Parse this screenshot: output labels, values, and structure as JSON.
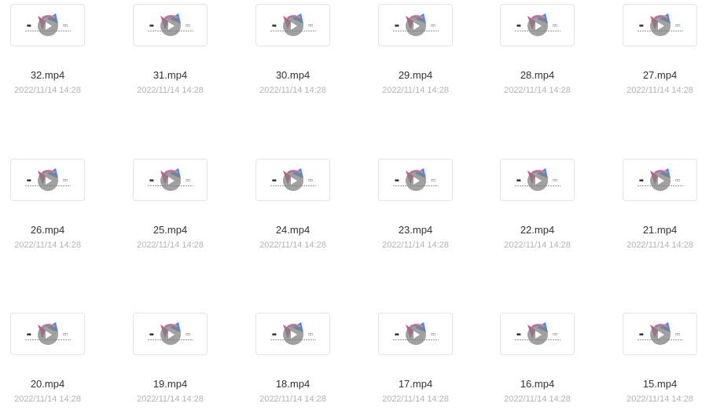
{
  "files": [
    {
      "name": "32.mp4",
      "date": "2022/11/14 14:28"
    },
    {
      "name": "31.mp4",
      "date": "2022/11/14 14:28"
    },
    {
      "name": "30.mp4",
      "date": "2022/11/14 14:28"
    },
    {
      "name": "29.mp4",
      "date": "2022/11/14 14:28"
    },
    {
      "name": "28.mp4",
      "date": "2022/11/14 14:28"
    },
    {
      "name": "27.mp4",
      "date": "2022/11/14 14:28"
    },
    {
      "name": "26.mp4",
      "date": "2022/11/14 14:28"
    },
    {
      "name": "25.mp4",
      "date": "2022/11/14 14:28"
    },
    {
      "name": "24.mp4",
      "date": "2022/11/14 14:28"
    },
    {
      "name": "23.mp4",
      "date": "2022/11/14 14:28"
    },
    {
      "name": "22.mp4",
      "date": "2022/11/14 14:28"
    },
    {
      "name": "21.mp4",
      "date": "2022/11/14 14:28"
    },
    {
      "name": "20.mp4",
      "date": "2022/11/14 14:28"
    },
    {
      "name": "19.mp4",
      "date": "2022/11/14 14:28"
    },
    {
      "name": "18.mp4",
      "date": "2022/11/14 14:28"
    },
    {
      "name": "17.mp4",
      "date": "2022/11/14 14:28"
    },
    {
      "name": "16.mp4",
      "date": "2022/11/14 14:28"
    },
    {
      "name": "15.mp4",
      "date": "2022/11/14 14:28"
    }
  ],
  "thumbnail": {
    "play_icon": "play-icon",
    "logo_icon": "brand-logo-icon",
    "colors": {
      "logo_pink": "#e84a9b",
      "logo_blue": "#3a8ef0",
      "play_bg": "#8a8a8a"
    }
  }
}
